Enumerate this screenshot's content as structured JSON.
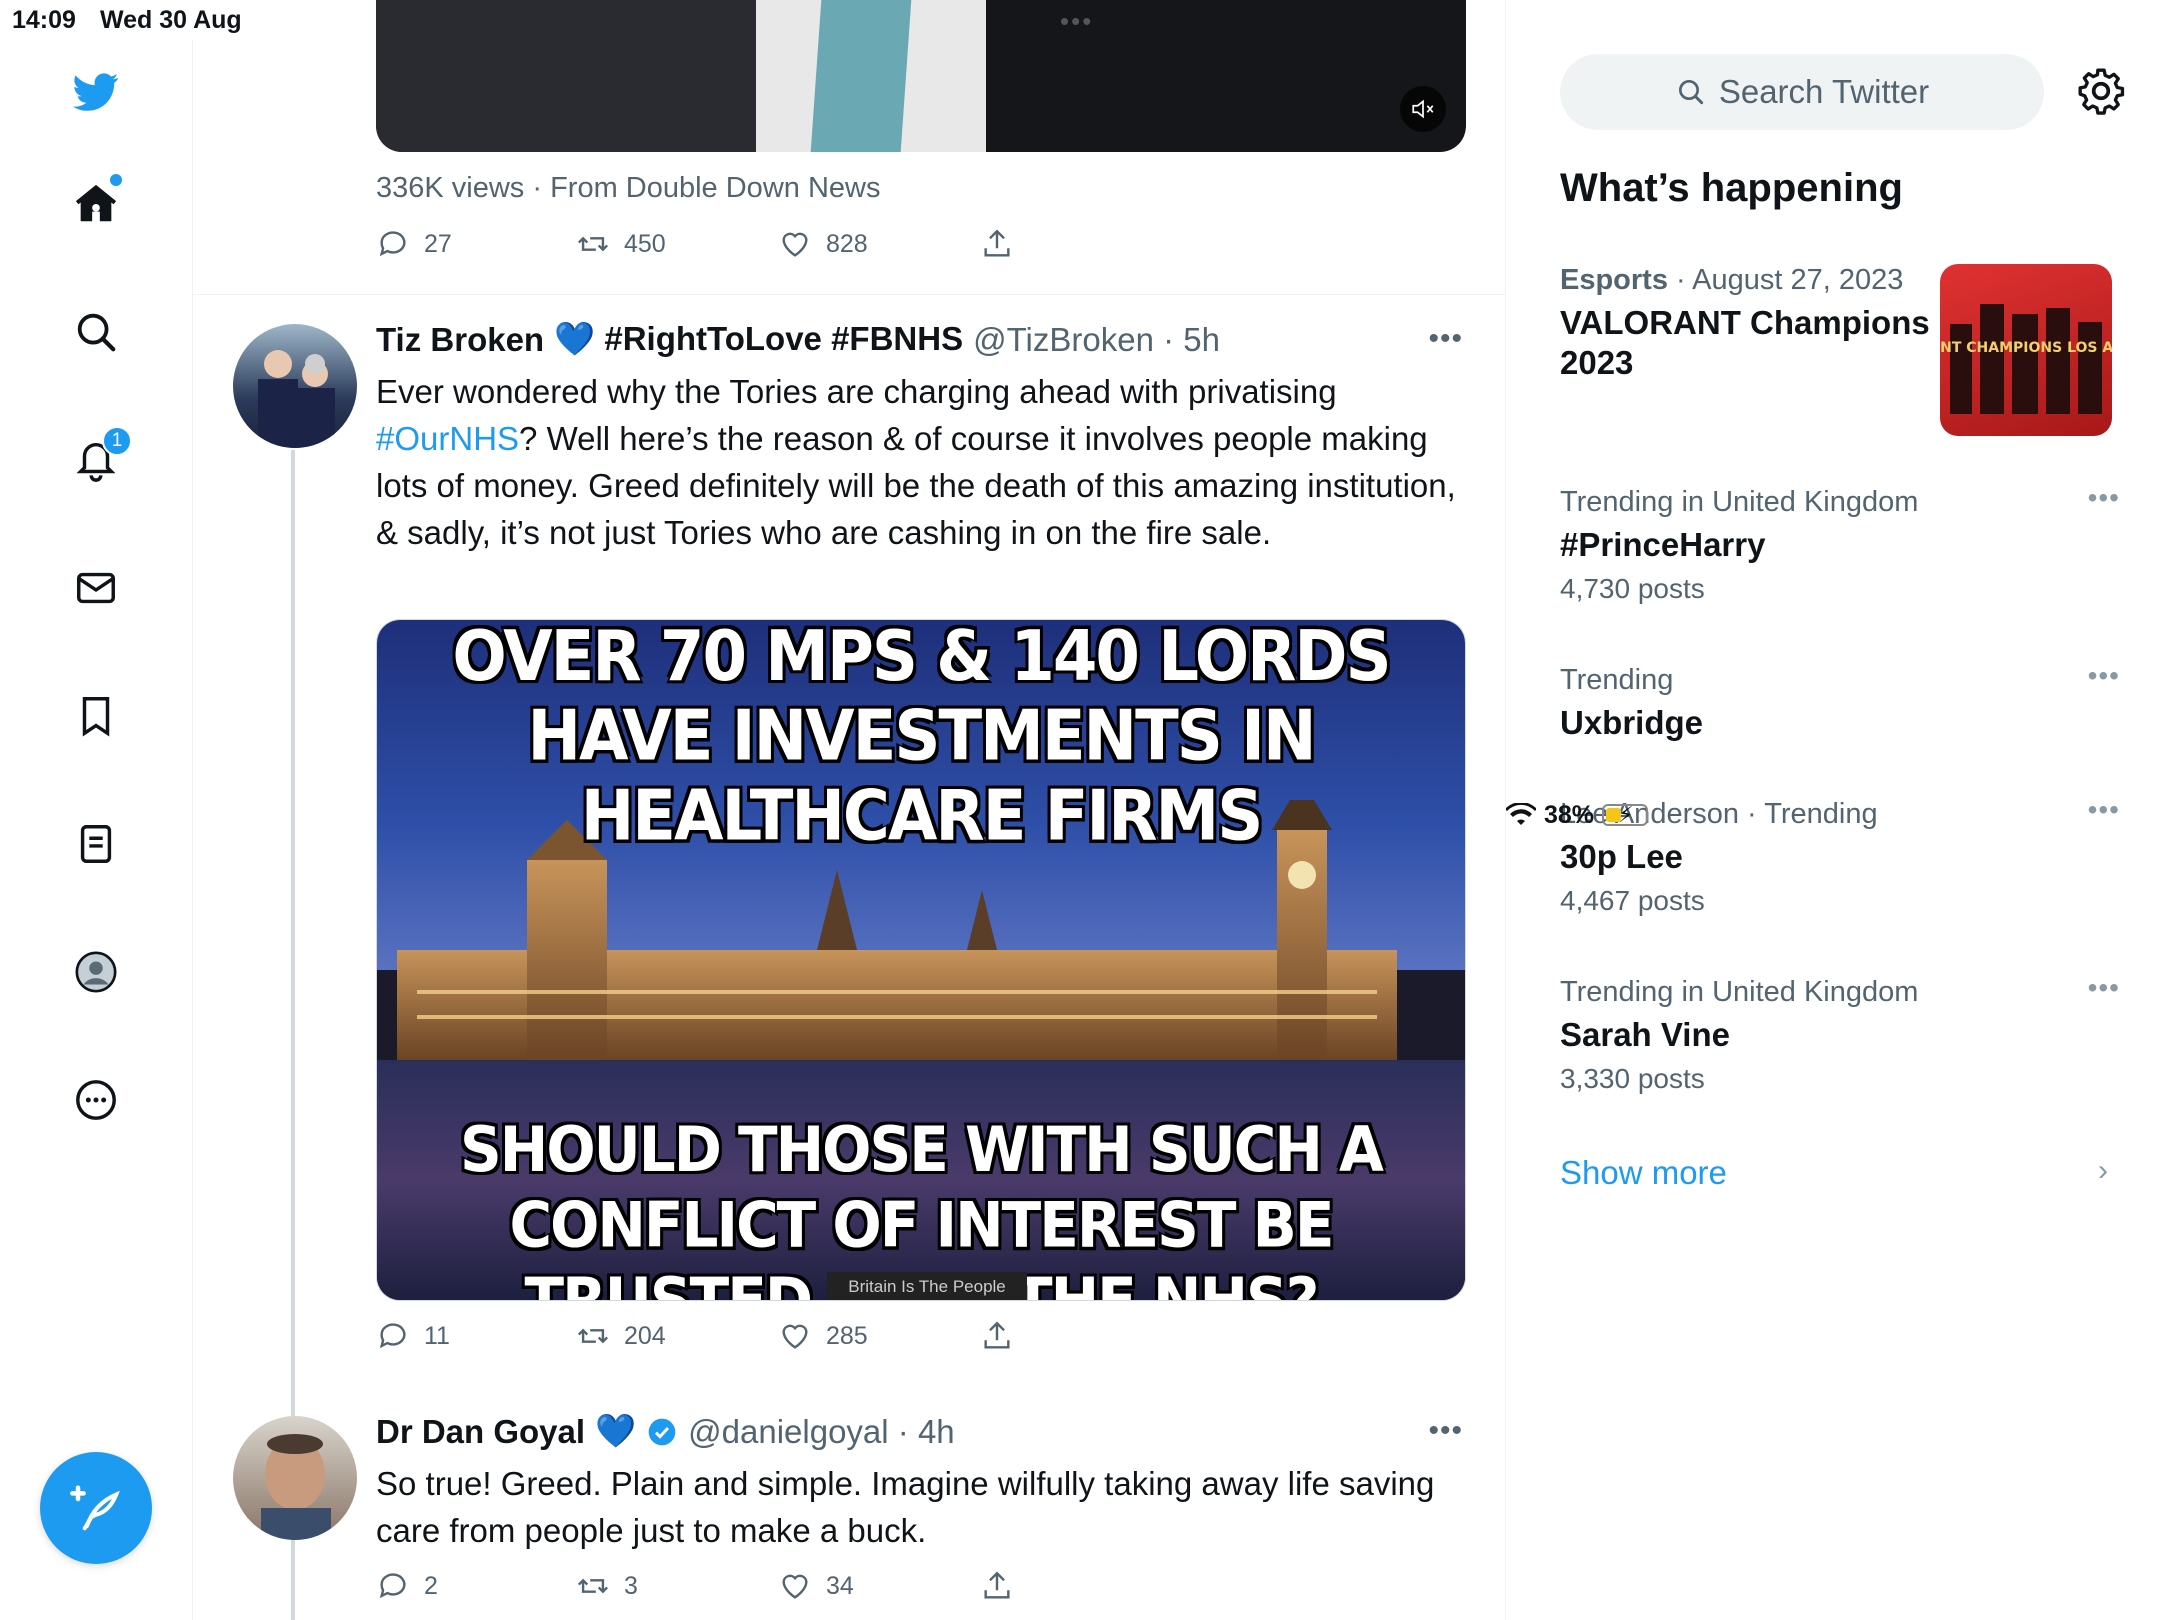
{
  "status_bar": {
    "time": "14:09",
    "date": "Wed 30 Aug",
    "battery": "38%"
  },
  "nav": {
    "notifications_badge": "1"
  },
  "prev_tweet": {
    "views_line": "336K views · From Double Down News",
    "replies": "27",
    "retweets": "450",
    "likes": "828"
  },
  "tweet1": {
    "name": "Tiz Broken",
    "name_suffix": "💙 #RightToLove #FBNHS",
    "handle": "@TizBroken · 5h",
    "text_before": "Ever wondered why the Tories are charging ahead with privatising ",
    "hashtag": "#OurNHS",
    "text_after": "? Well here’s the reason & of course it involves people making lots of money. Greed definitely will be the death of this amazing institution, & sadly, it’s not just Tories who are cashing in on the fire sale.",
    "image_top": "OVER 70 MPS & 140 LORDS HAVE INVESTMENTS IN HEALTHCARE FIRMS",
    "image_bottom": "SHOULD THOSE WITH SUCH A CONFLICT OF INTEREST BE TRUSTED WITH THE NHS?",
    "image_credit": "Britain Is The People",
    "replies": "11",
    "retweets": "204",
    "likes": "285"
  },
  "tweet2": {
    "name": "Dr Dan Goyal",
    "heart": "💙",
    "handle": "@danielgoyal · 4h",
    "text": "So true! Greed. Plain and simple. Imagine wilfully taking away life saving care from people just to make a buck.",
    "replies": "2",
    "retweets": "3",
    "likes": "34"
  },
  "sidebar": {
    "search_placeholder": "Search Twitter",
    "title": "What’s happening",
    "trends": [
      {
        "ctx": "Esports",
        "ctx2": " · August 27, 2023",
        "topic": "VALORANT Champions 2023",
        "count": ""
      },
      {
        "ctx": "Trending in United Kingdom",
        "ctx2": "",
        "topic": "#PrinceHarry",
        "count": "4,730 posts"
      },
      {
        "ctx": "Trending",
        "ctx2": "",
        "topic": "Uxbridge",
        "count": ""
      },
      {
        "ctx": "Lee Anderson · Trending",
        "ctx2": "",
        "topic": "30p Lee",
        "count": "4,467 posts"
      },
      {
        "ctx": "Trending in United Kingdom",
        "ctx2": "",
        "topic": "Sarah Vine",
        "count": "3,330 posts"
      }
    ],
    "show_more": "Show more",
    "thumb_text": "VALORANT CHAMPIONS LOS ANGELES"
  },
  "colors": {
    "accent": "#1d9bf0",
    "muted": "#536471"
  }
}
